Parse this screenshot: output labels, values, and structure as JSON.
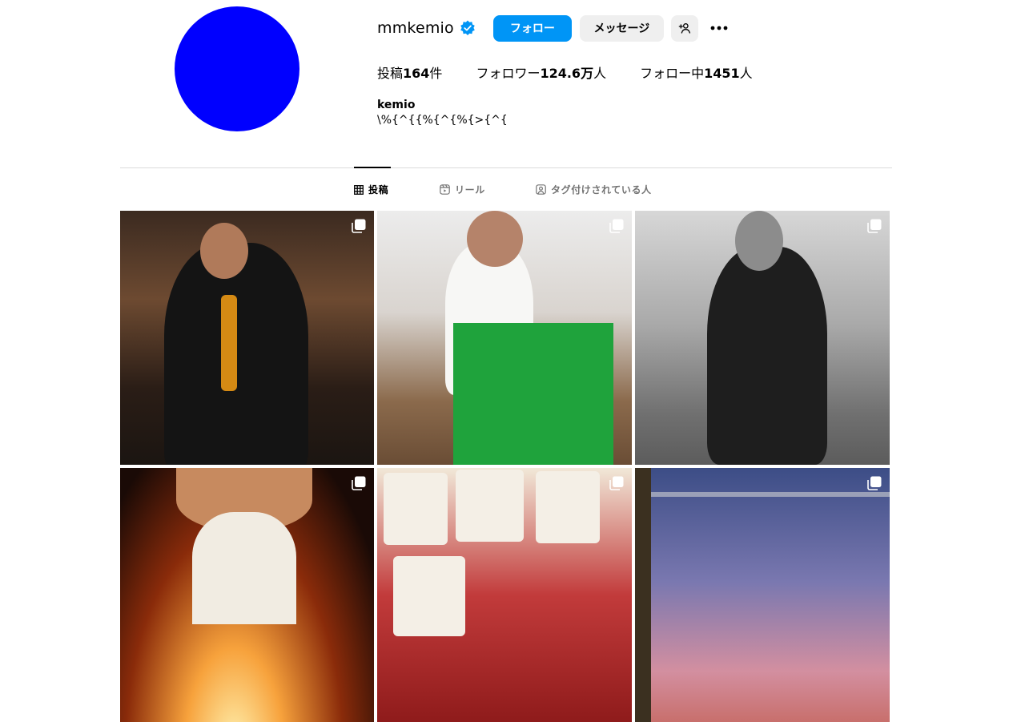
{
  "profile": {
    "username": "mmkemio",
    "full_name": "kemio",
    "bio": "\\%{^{{%{^{%{>{^{",
    "avatar_color": "#0000ff",
    "verified": true
  },
  "actions": {
    "follow_label": "フォロー",
    "message_label": "メッセージ",
    "suggest_icon": "person-add-icon",
    "more_icon": "more-horizontal-icon"
  },
  "stats": {
    "posts_label": "投稿",
    "posts_count": "164",
    "posts_suffix": "件",
    "followers_label": "フォロワー",
    "followers_count": "124.6万",
    "followers_suffix": "人",
    "following_label": "フォロー中",
    "following_count": "1451",
    "following_suffix": "人"
  },
  "tabs": [
    {
      "label": "投稿",
      "icon": "grid-icon",
      "active": true
    },
    {
      "label": "リール",
      "icon": "reels-icon",
      "active": false
    },
    {
      "label": "タグ付けされている人",
      "icon": "tagged-icon",
      "active": false
    }
  ],
  "posts": [
    {
      "description": "mirror selfie",
      "multi": true
    },
    {
      "description": "BOTTEGA VENETA",
      "multi": true
    },
    {
      "description": "street black and white",
      "multi": true
    },
    {
      "description": "birthday candles",
      "multi": true
    },
    {
      "description": "photo booth strips",
      "multi": true
    },
    {
      "description": "train window sunset",
      "multi": true
    }
  ],
  "colors": {
    "accent": "#0095f6",
    "secondary_button": "#efefef",
    "divider": "#dbdbdb",
    "muted_text": "#737373",
    "verified_badge": "#0095f6"
  }
}
